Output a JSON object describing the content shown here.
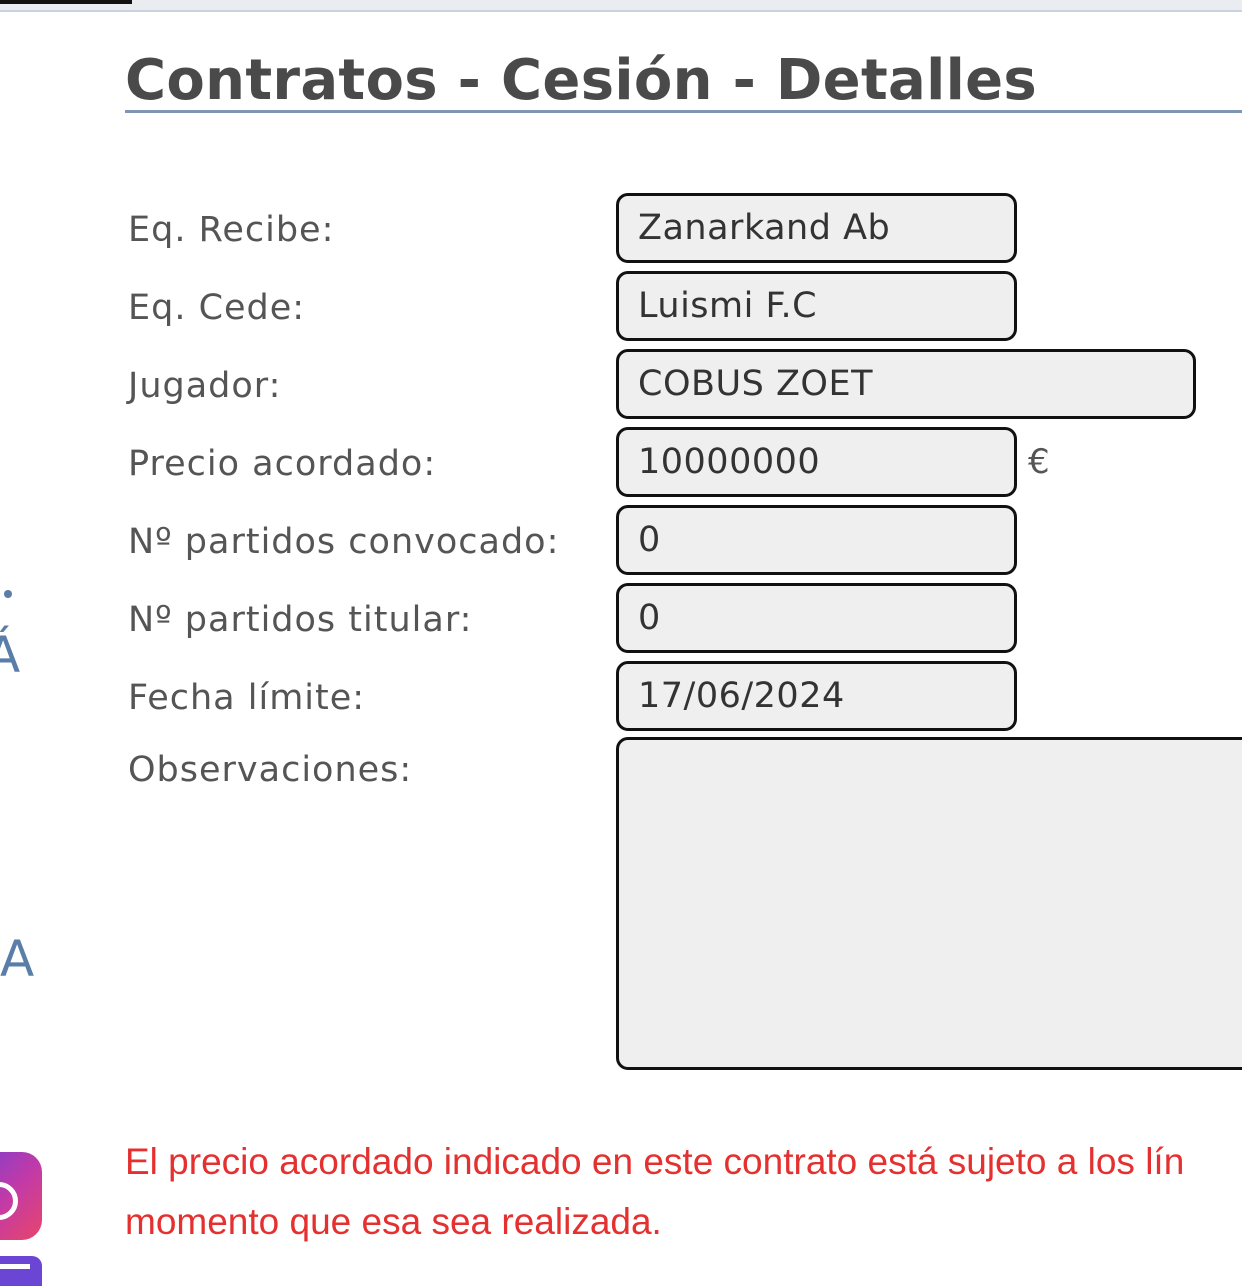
{
  "page": {
    "title": "Contratos - Cesión - Detalles"
  },
  "side": {
    "glyph_1": "Á",
    "glyph_2": "A"
  },
  "form": {
    "eq_recibe_label": "Eq. Recibe:",
    "eq_recibe_value": "Zanarkand Ab",
    "eq_cede_label": "Eq. Cede:",
    "eq_cede_value": "Luismi F.C",
    "jugador_label": "Jugador:",
    "jugador_value": "COBUS ZOET",
    "precio_label": "Precio acordado:",
    "precio_value": "10000000",
    "currency": "€",
    "convocado_label": "Nº partidos convocado:",
    "convocado_value": "0",
    "titular_label": "Nº partidos titular:",
    "titular_value": "0",
    "fecha_label": "Fecha límite:",
    "fecha_value": "17/06/2024",
    "observaciones_label": "Observaciones:",
    "observaciones_value": ""
  },
  "notice": {
    "line_1": "El precio acordado indicado en este contrato está sujeto a los lín",
    "line_2": "momento que esa sea realizada."
  },
  "colors": {
    "accent": "#7d97b3",
    "side_text": "#5a7ea8",
    "notice": "#e53030"
  },
  "icons": {
    "social_1": "instagram-icon",
    "social_2": "social-icon"
  }
}
